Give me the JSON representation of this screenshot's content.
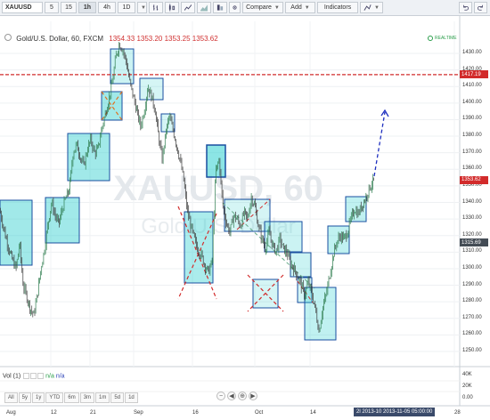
{
  "toolbar": {
    "symbol": "XAUUSD",
    "intervals": [
      "5",
      "15",
      "1h",
      "4h",
      "1D"
    ],
    "active_interval": "1h",
    "compare_label": "Compare",
    "add_label": "Add",
    "indicators_label": "Indicators",
    "icons": [
      "bar-style-icon",
      "candle-style-icon",
      "line-style-icon",
      "area-style-icon",
      "heikin-style-icon",
      "gear-icon",
      "drawing-icon",
      "undo-icon",
      "redo-icon"
    ]
  },
  "legend": {
    "title": "Gold/U.S. Dollar, 60, FXCM",
    "ohlc": [
      "1354.33",
      "1353.20",
      "1353.25",
      "1353.62"
    ],
    "realtime": "REALTIME"
  },
  "watermark": {
    "symbol": "XAUUSD, 60",
    "name": "Gold/U.S. Dollar"
  },
  "price_axis": {
    "ticks": [
      "1430.00",
      "1420.00",
      "1410.00",
      "1400.00",
      "1390.00",
      "1380.00",
      "1370.00",
      "1360.00",
      "1350.00",
      "1340.00",
      "1330.00",
      "1320.00",
      "1310.00",
      "1300.00",
      "1290.00",
      "1280.00",
      "1270.00",
      "1260.00",
      "1250.00"
    ],
    "tags": [
      {
        "label": "1417.19",
        "color": "#d22b2b"
      },
      {
        "label": "1353.62",
        "color": "#d22b2b"
      },
      {
        "label": "1315.69",
        "color": "#444c55"
      }
    ]
  },
  "volume": {
    "label": "Vol (1)",
    "val1": "n/a",
    "val2": "n/a",
    "ticks": [
      "40K",
      "20K",
      "0.00"
    ]
  },
  "time_axis": {
    "labels": [
      "Aug",
      "12",
      "21",
      "Sep",
      "16",
      "Oct",
      "14",
      "28"
    ],
    "selection": "2l 2013-10",
    "selection2": "2013-11-05 05:00:00"
  },
  "ranges": [
    "All",
    "5y",
    "1y",
    "YTD",
    "6m",
    "3m",
    "1m",
    "5d",
    "1d"
  ],
  "zoom_buttons": [
    "−",
    "◀",
    "⊕",
    "▶"
  ],
  "colors": {
    "up_candle": "#2e7d4f",
    "down_candle": "#3b3b3b",
    "box_fill": "#2ecfcf",
    "box_border": "#1a4fa0",
    "resistance": "#d22b2b",
    "arrow": "#1e2fbf"
  },
  "chart_data": {
    "type": "candlestick",
    "symbol": "Gold/U.S. Dollar",
    "timeframe": "60",
    "y_range": [
      1245,
      1445
    ],
    "resistance_level": 1417.19,
    "last_price": 1353.62,
    "projection_target": 1395,
    "path": [
      [
        0,
        1335
      ],
      [
        6,
        1320
      ],
      [
        12,
        1308
      ],
      [
        18,
        1300
      ],
      [
        22,
        1316
      ],
      [
        26,
        1290
      ],
      [
        30,
        1283
      ],
      [
        34,
        1276
      ],
      [
        38,
        1272
      ],
      [
        42,
        1285
      ],
      [
        46,
        1300
      ],
      [
        50,
        1312
      ],
      [
        54,
        1328
      ],
      [
        58,
        1340
      ],
      [
        62,
        1332
      ],
      [
        66,
        1327
      ],
      [
        70,
        1336
      ],
      [
        74,
        1343
      ],
      [
        78,
        1348
      ],
      [
        82,
        1370
      ],
      [
        86,
        1375
      ],
      [
        90,
        1368
      ],
      [
        94,
        1362
      ],
      [
        98,
        1372
      ],
      [
        102,
        1378
      ],
      [
        106,
        1370
      ],
      [
        110,
        1372
      ],
      [
        114,
        1384
      ],
      [
        118,
        1393
      ],
      [
        122,
        1402
      ],
      [
        126,
        1412
      ],
      [
        130,
        1428
      ],
      [
        134,
        1436
      ],
      [
        138,
        1432
      ],
      [
        142,
        1424
      ],
      [
        146,
        1412
      ],
      [
        150,
        1403
      ],
      [
        154,
        1394
      ],
      [
        158,
        1386
      ],
      [
        162,
        1396
      ],
      [
        166,
        1410
      ],
      [
        170,
        1404
      ],
      [
        174,
        1396
      ],
      [
        178,
        1380
      ],
      [
        182,
        1366
      ],
      [
        186,
        1382
      ],
      [
        190,
        1392
      ],
      [
        194,
        1384
      ],
      [
        198,
        1375
      ],
      [
        202,
        1366
      ],
      [
        206,
        1354
      ],
      [
        210,
        1336
      ],
      [
        214,
        1326
      ],
      [
        218,
        1318
      ],
      [
        222,
        1312
      ],
      [
        226,
        1308
      ],
      [
        230,
        1302
      ],
      [
        234,
        1298
      ],
      [
        238,
        1304
      ],
      [
        242,
        1358
      ],
      [
        246,
        1366
      ],
      [
        250,
        1338
      ],
      [
        254,
        1328
      ],
      [
        258,
        1322
      ],
      [
        262,
        1332
      ],
      [
        266,
        1330
      ],
      [
        270,
        1326
      ],
      [
        274,
        1334
      ],
      [
        278,
        1330
      ],
      [
        282,
        1343
      ],
      [
        286,
        1338
      ],
      [
        290,
        1326
      ],
      [
        294,
        1318
      ],
      [
        298,
        1312
      ],
      [
        302,
        1322
      ],
      [
        306,
        1314
      ],
      [
        310,
        1310
      ],
      [
        314,
        1318
      ],
      [
        318,
        1312
      ],
      [
        322,
        1310
      ],
      [
        326,
        1303
      ],
      [
        330,
        1300
      ],
      [
        334,
        1296
      ],
      [
        338,
        1290
      ],
      [
        342,
        1284
      ],
      [
        346,
        1292
      ],
      [
        350,
        1284
      ],
      [
        354,
        1276
      ],
      [
        358,
        1262
      ],
      [
        362,
        1276
      ],
      [
        366,
        1284
      ],
      [
        370,
        1296
      ],
      [
        374,
        1308
      ],
      [
        378,
        1316
      ],
      [
        382,
        1320
      ],
      [
        386,
        1318
      ],
      [
        390,
        1322
      ],
      [
        394,
        1330
      ],
      [
        398,
        1336
      ],
      [
        402,
        1333
      ],
      [
        406,
        1338
      ],
      [
        410,
        1342
      ],
      [
        414,
        1348
      ],
      [
        418,
        1352
      ],
      [
        420,
        1354
      ]
    ]
  }
}
